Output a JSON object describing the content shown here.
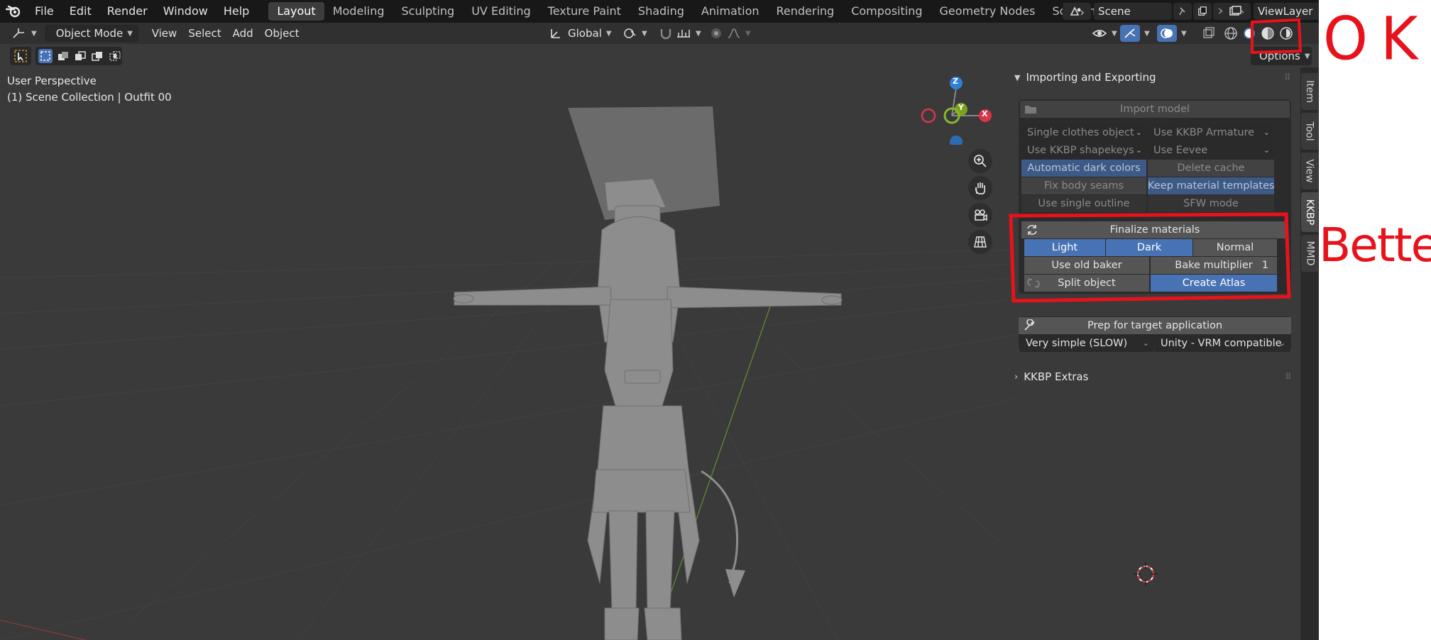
{
  "topbar": {
    "menus": [
      "File",
      "Edit",
      "Render",
      "Window",
      "Help"
    ],
    "workspaces": [
      "Layout",
      "Modeling",
      "Sculpting",
      "UV Editing",
      "Texture Paint",
      "Shading",
      "Animation",
      "Rendering",
      "Compositing",
      "Geometry Nodes",
      "Scripting"
    ],
    "active_workspace": "Layout",
    "add_workspace": "+",
    "scene": "Scene",
    "view_layer": "ViewLayer"
  },
  "header": {
    "mode": "Object Mode",
    "menus": [
      "View",
      "Select",
      "Add",
      "Object"
    ],
    "transform_orientation": "Global",
    "options_label": "Options"
  },
  "viewport": {
    "perspective": "User Perspective",
    "collection": "(1) Scene Collection | Outfit 00",
    "gizmo": {
      "z": "Z",
      "y": "Y",
      "x": "X"
    }
  },
  "npanel": {
    "section_title": "Importing and Exporting",
    "import_model": "Import model",
    "import_rows": [
      {
        "left": "Single clothes object",
        "right": "Use KKBP Armature"
      },
      {
        "left": "Use KKBP shapekeys",
        "right": "Use Eevee"
      },
      {
        "left": "Automatic dark colors",
        "right": "Delete cache"
      },
      {
        "left": "Fix body seams",
        "right": "Keep material templates"
      },
      {
        "left": "Use single outline",
        "right": "SFW mode"
      }
    ],
    "finalize_materials": "Finalize materials",
    "light": "Light",
    "dark": "Dark",
    "normal": "Normal",
    "use_old_baker": "Use old baker",
    "bake_multiplier_label": "Bake multiplier",
    "bake_multiplier_value": "1",
    "split_object": "Split object",
    "create_atlas": "Create Atlas",
    "prep_target": "Prep for target application",
    "prep_left": "Very simple (SLOW)",
    "prep_right": "Unity  -  VRM compatible",
    "extras_title": "KKBP Extras",
    "side_tabs": [
      "Item",
      "Tool",
      "View",
      "KKBP",
      "MMD"
    ],
    "active_tab": "KKBP"
  },
  "annotations": {
    "ok": "OK",
    "better": "Better",
    "color": "#e8121b"
  },
  "colors": {
    "accent_blue": "#4772b3",
    "viewport_bg": "#3a3a3a",
    "topbar_bg": "#181818"
  }
}
